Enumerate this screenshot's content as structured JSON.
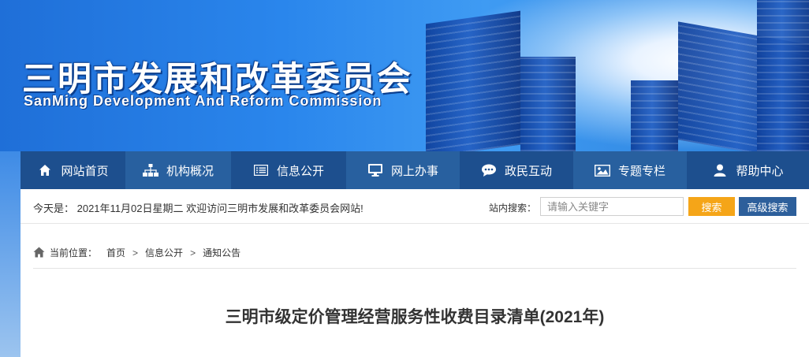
{
  "header": {
    "title_cn": "三明市发展和改革委员会",
    "title_en": "SanMing Development And Reform Commission"
  },
  "nav": {
    "items": [
      {
        "label": "网站首页",
        "icon": "home-icon"
      },
      {
        "label": "机构概况",
        "icon": "org-chart-icon"
      },
      {
        "label": "信息公开",
        "icon": "document-icon"
      },
      {
        "label": "网上办事",
        "icon": "monitor-icon"
      },
      {
        "label": "政民互动",
        "icon": "chat-icon"
      },
      {
        "label": "专题专栏",
        "icon": "image-icon"
      },
      {
        "label": "帮助中心",
        "icon": "user-icon"
      }
    ]
  },
  "info_bar": {
    "date_text": "今天是：  2021年11月02日星期二  欢迎访问三明市发展和改革委员会网站!",
    "search_label": "站内搜索：",
    "search_placeholder": "请输入关键字",
    "search_button": "搜索",
    "advanced_search_button": "高级搜索"
  },
  "breadcrumb": {
    "label": "当前位置：",
    "items": [
      "首页",
      "信息公开",
      "通知公告"
    ],
    "separator": ">"
  },
  "article": {
    "title": "三明市级定价管理经营服务性收费目录清单(2021年)"
  },
  "colors": {
    "nav_bg": "#1d4f8e",
    "nav_alt_bg": "#28609f",
    "search_button": "#f5a518",
    "advanced_button": "#2d5f9b"
  }
}
